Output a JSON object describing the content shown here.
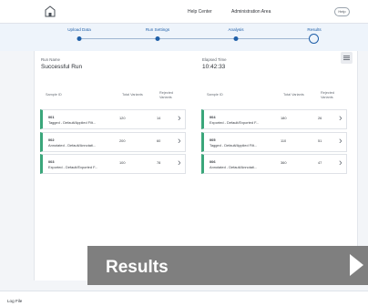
{
  "topbar": {
    "link_1": "Help Center",
    "link_2": "Administration Area",
    "help_button": "Help"
  },
  "stepper": {
    "steps": [
      {
        "label": "Upload Data"
      },
      {
        "label": "Run Settings"
      },
      {
        "label": "Analysis"
      },
      {
        "label": "Results"
      }
    ],
    "current_step": 4
  },
  "summary": {
    "run_name_label": "Run Name",
    "run_name_value": "Successful Run",
    "elapsed_label": "Elapsed Time",
    "elapsed_value": "10:42:33"
  },
  "left_table": {
    "headers": {
      "id": "Sample ID",
      "total": "Total Variants",
      "rejected_line1": "Rejected",
      "rejected_line2": "Variants"
    },
    "rows": [
      {
        "id": "001",
        "desc": "Tagged - Default/Applied Filt...",
        "total": "120",
        "rejected": "14"
      },
      {
        "id": "002",
        "desc": "Annotated - Default/Annotati...",
        "total": "200",
        "rejected": "60"
      },
      {
        "id": "003",
        "desc": "Exported - Default/Exported F...",
        "total": "100",
        "rejected": "78"
      }
    ]
  },
  "right_table": {
    "headers": {
      "id": "Sample ID",
      "total": "Total Variants",
      "rejected_line1": "Rejected",
      "rejected_line2": "Variants"
    },
    "rows": [
      {
        "id": "004",
        "desc": "Exported - Default/Exported F...",
        "total": "180",
        "rejected": "26"
      },
      {
        "id": "005",
        "desc": "Tagged - Default/Applied Filt...",
        "total": "110",
        "rejected": "51"
      },
      {
        "id": "006",
        "desc": "Annotated - Default/Annotati...",
        "total": "360",
        "rejected": "47"
      }
    ]
  },
  "banner": {
    "title": "Results"
  },
  "footer": {
    "text": "Log File"
  },
  "colors": {
    "accent": "#1f5fa8",
    "success": "#3aa67a",
    "banner": "#7f7f7f"
  }
}
